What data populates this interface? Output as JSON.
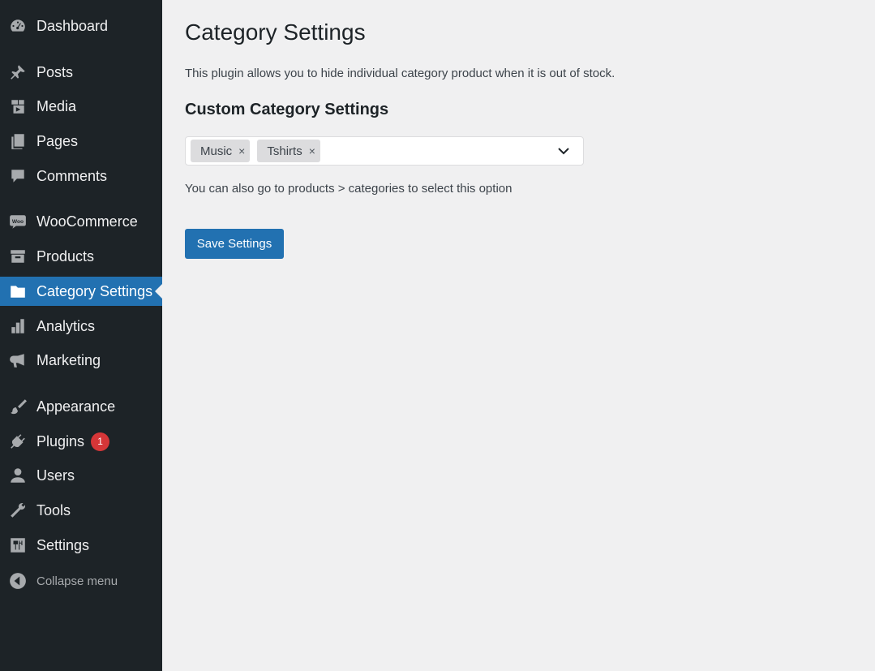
{
  "sidebar": {
    "items": [
      {
        "label": "Dashboard",
        "icon": "dashboard-icon"
      },
      {
        "label": "Posts",
        "icon": "pin-icon"
      },
      {
        "label": "Media",
        "icon": "media-icon"
      },
      {
        "label": "Pages",
        "icon": "pages-icon"
      },
      {
        "label": "Comments",
        "icon": "comment-icon"
      },
      {
        "label": "WooCommerce",
        "icon": "woo-icon"
      },
      {
        "label": "Products",
        "icon": "archive-icon"
      },
      {
        "label": "Category Settings",
        "icon": "folder-icon",
        "current": true
      },
      {
        "label": "Analytics",
        "icon": "bar-chart-icon"
      },
      {
        "label": "Marketing",
        "icon": "megaphone-icon"
      },
      {
        "label": "Appearance",
        "icon": "paintbrush-icon"
      },
      {
        "label": "Plugins",
        "icon": "plugin-icon",
        "badge": "1"
      },
      {
        "label": "Users",
        "icon": "user-icon"
      },
      {
        "label": "Tools",
        "icon": "wrench-icon"
      },
      {
        "label": "Settings",
        "icon": "settings-icon"
      },
      {
        "label": "Collapse menu",
        "icon": "collapse-icon"
      }
    ]
  },
  "main": {
    "title": "Category Settings",
    "description": "This plugin allows you to hide individual category product when it is out of stock.",
    "section_title": "Custom Category Settings",
    "selected_categories": [
      "Music",
      "Tshirts"
    ],
    "remove_symbol": "×",
    "help_text": "You can also go to products > categories to select this option",
    "save_label": "Save Settings"
  },
  "colors": {
    "sidebar_bg": "#1d2327",
    "accent": "#2271b1",
    "badge": "#d63638",
    "page_bg": "#f0f0f1"
  }
}
